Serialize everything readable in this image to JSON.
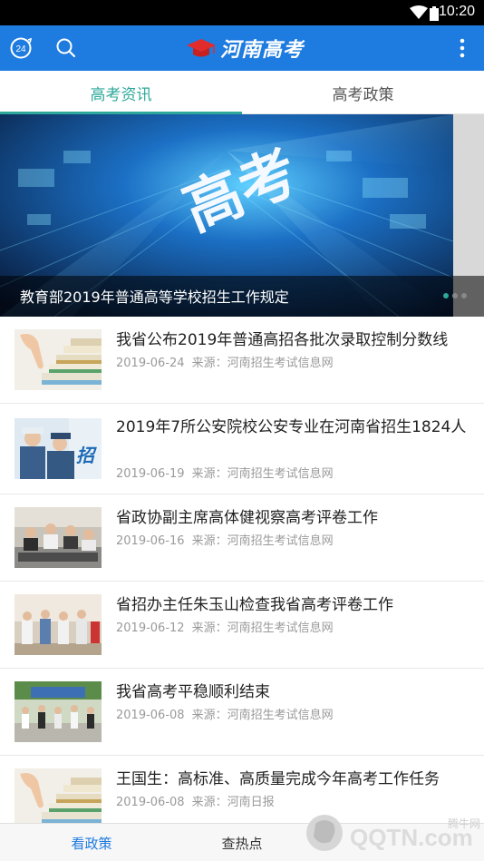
{
  "status_bar": {
    "time": "10:20"
  },
  "app_bar": {
    "title": "河南高考",
    "left_icons": [
      "24h-icon",
      "search-icon"
    ],
    "right_icon": "more-vertical-icon",
    "color": "#1e7be0"
  },
  "tabs": [
    {
      "label": "高考资讯",
      "active": true
    },
    {
      "label": "高考政策",
      "active": false
    }
  ],
  "accent_color": "#2ea89a",
  "banner": {
    "image_text": "高考",
    "caption": "教育部2019年普通高等学校招生工作规定"
  },
  "news": [
    {
      "title": "我省公布2019年普通高招各批次录取控制分数线",
      "date": "2019-06-24",
      "source": "来源：河南招生考试信息网"
    },
    {
      "title": "2019年7所公安院校公安专业在河南省招生1824人",
      "date": "2019-06-19",
      "source": "来源：河南招生考试信息网"
    },
    {
      "title": "省政协副主席高体健视察高考评卷工作",
      "date": "2019-06-16",
      "source": "来源：河南招生考试信息网"
    },
    {
      "title": "省招办主任朱玉山检查我省高考评卷工作",
      "date": "2019-06-12",
      "source": "来源：河南招生考试信息网"
    },
    {
      "title": "我省高考平稳顺利结束",
      "date": "2019-06-08",
      "source": "来源：河南招生考试信息网"
    },
    {
      "title": "王国生：高标准、高质量完成今年高考工作任务",
      "date": "2019-06-08",
      "source": "来源：河南日报"
    }
  ],
  "bottom_nav": [
    {
      "label": "看政策",
      "active": true
    },
    {
      "label": "查热点",
      "active": false
    },
    {
      "label": "",
      "active": false
    }
  ],
  "watermark": {
    "text": "腾牛网",
    "logo": "QQTN.com"
  }
}
